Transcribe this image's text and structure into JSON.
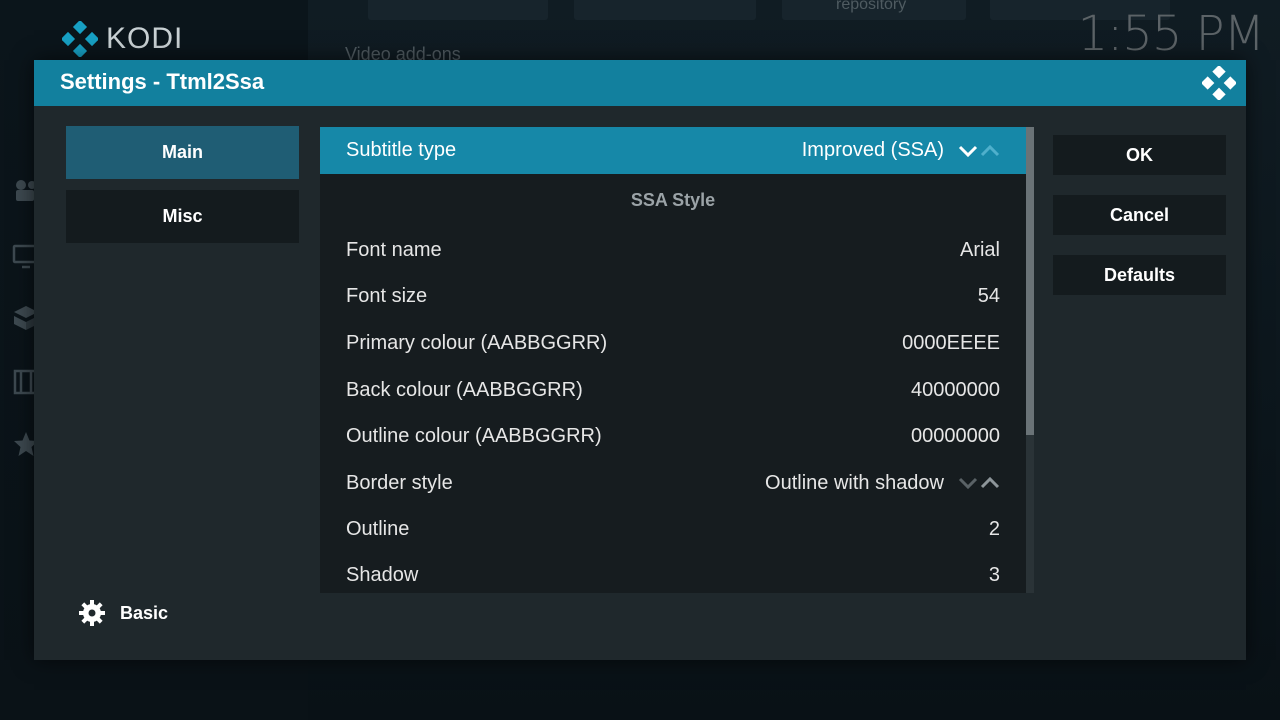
{
  "background": {
    "logo_text": "KODI",
    "clock": "1:55 PM",
    "section_label": "Video add-ons",
    "tile_label": "repository",
    "side_icons": [
      "movies-icon",
      "tv-icon",
      "addons-icon",
      "film-icon",
      "favourites-icon"
    ]
  },
  "dialog": {
    "title": "Settings - Ttml2Ssa",
    "categories": [
      {
        "label": "Main",
        "active": true
      },
      {
        "label": "Misc",
        "active": false
      }
    ],
    "level_label": "Basic",
    "settings": {
      "subtitle_type": {
        "label": "Subtitle type",
        "value": "Improved (SSA)"
      },
      "section_title": "SSA Style",
      "rows": [
        {
          "label": "Font name",
          "value": "Arial"
        },
        {
          "label": "Font size",
          "value": "54"
        },
        {
          "label": "Primary colour (AABBGGRR)",
          "value": "0000EEEE"
        },
        {
          "label": "Back colour (AABBGGRR)",
          "value": "40000000"
        },
        {
          "label": "Outline colour (AABBGGRR)",
          "value": "00000000"
        },
        {
          "label": "Border style",
          "value": "Outline with shadow"
        },
        {
          "label": "Outline",
          "value": "2"
        },
        {
          "label": "Shadow",
          "value": "3"
        }
      ]
    },
    "actions": {
      "ok": "OK",
      "cancel": "Cancel",
      "defaults": "Defaults"
    }
  },
  "colors": {
    "accent": "#12809e",
    "focus": "#1688a8",
    "active_category": "#1f5d74"
  }
}
